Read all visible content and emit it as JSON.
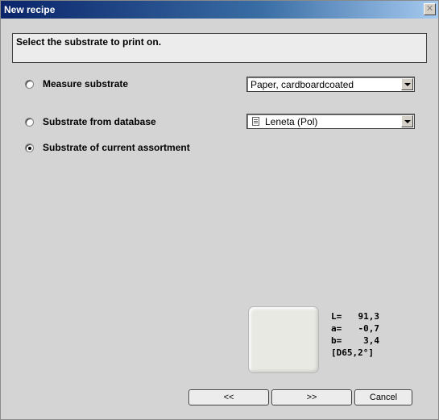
{
  "window": {
    "title": "New recipe",
    "close_glyph": "✕"
  },
  "instruction": "Select the substrate to print on.",
  "options": [
    {
      "label": "Measure substrate",
      "checked": false
    },
    {
      "label": "Substrate from database",
      "checked": false
    },
    {
      "label": "Substrate of current assortment",
      "checked": true
    }
  ],
  "measure_combo": {
    "value": "Paper, cardboardcoated"
  },
  "database_combo": {
    "value": "Leneta (Pol)",
    "icon": "document-icon"
  },
  "color_values": {
    "L_label": "L=",
    "L_value": "91,3",
    "a_label": "a=",
    "a_value": "-0,7",
    "b_label": "b=",
    "b_value": "3,4",
    "illuminant": "[D65,2°]",
    "swatch_color": "#e9e9e4"
  },
  "buttons": {
    "back": "<<",
    "next": ">>",
    "cancel": "Cancel"
  }
}
